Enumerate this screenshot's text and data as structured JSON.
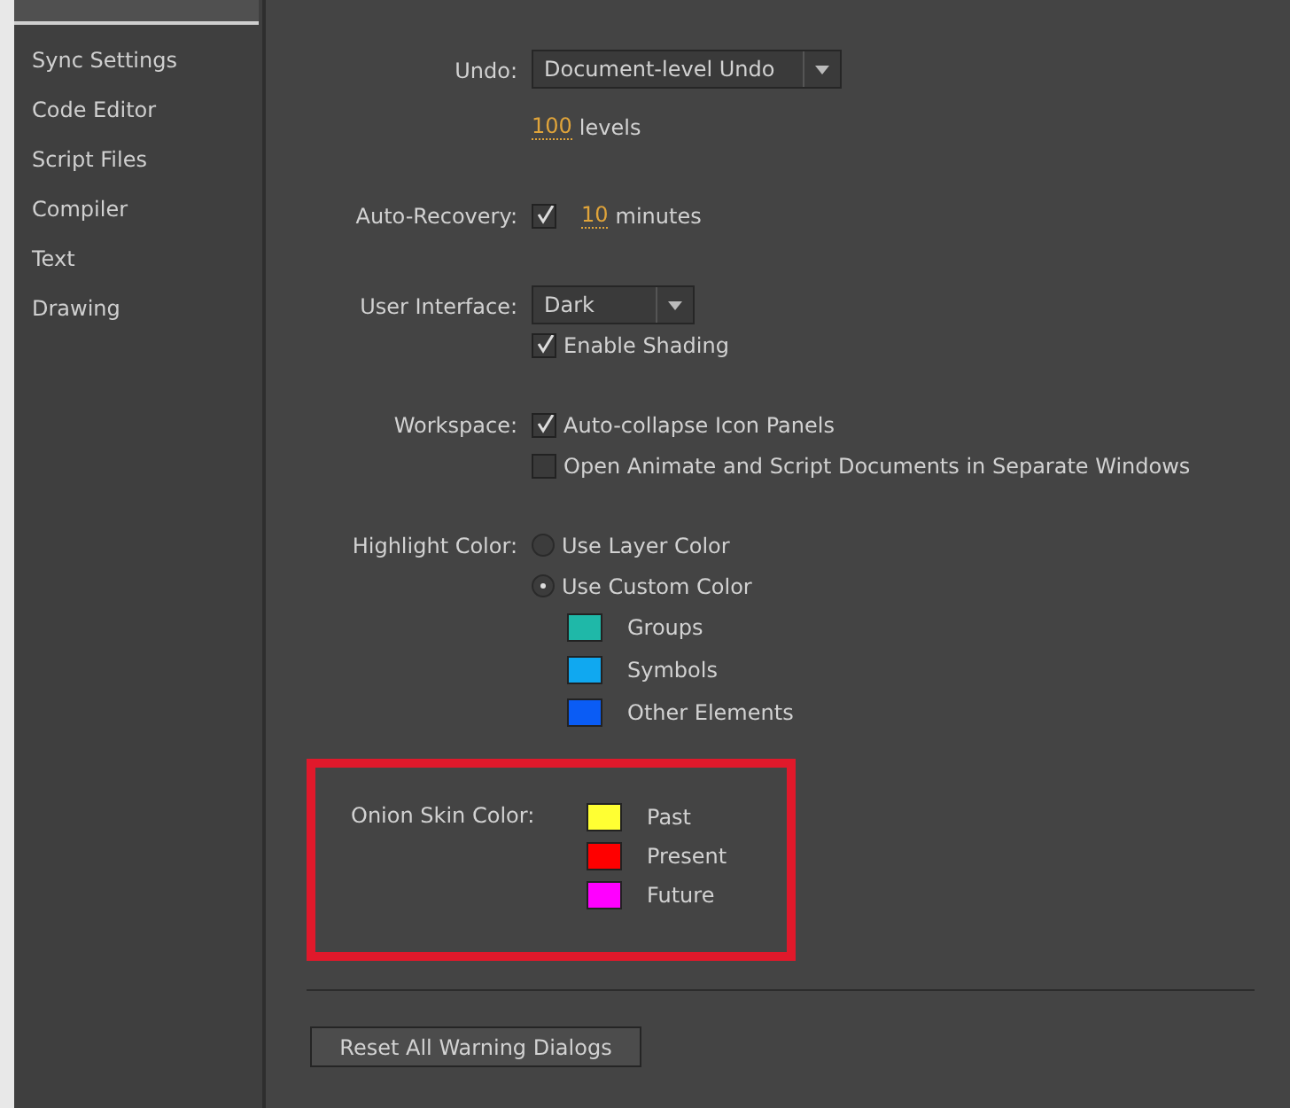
{
  "sidebar": {
    "items": [
      {
        "label": "Sync Settings",
        "selected": false
      },
      {
        "label": "Code Editor",
        "selected": false
      },
      {
        "label": "Script Files",
        "selected": false
      },
      {
        "label": "Compiler",
        "selected": false
      },
      {
        "label": "Text",
        "selected": false
      },
      {
        "label": "Drawing",
        "selected": false
      }
    ]
  },
  "undo": {
    "label": "Undo:",
    "value": "Document-level Undo",
    "amount": "100",
    "unit": "levels"
  },
  "auto_recovery": {
    "label": "Auto-Recovery:",
    "checked": true,
    "amount": "10",
    "unit": "minutes"
  },
  "user_interface": {
    "label": "User Interface:",
    "value": "Dark",
    "shading": {
      "label": "Enable Shading",
      "checked": true
    }
  },
  "workspace": {
    "label": "Workspace:",
    "options": [
      {
        "label": "Auto-collapse Icon Panels",
        "checked": true
      },
      {
        "label": "Open Animate and Script Documents in Separate Windows",
        "checked": false
      }
    ]
  },
  "highlight_color": {
    "label": "Highlight Color:",
    "options": [
      {
        "label": "Use Layer Color",
        "selected": false
      },
      {
        "label": "Use Custom Color",
        "selected": true
      }
    ],
    "swatches": [
      {
        "label": "Groups",
        "color": "#1fb8a8"
      },
      {
        "label": "Symbols",
        "color": "#10a8f0"
      },
      {
        "label": "Other Elements",
        "color": "#0a5cf5"
      }
    ]
  },
  "onion_skin": {
    "label": "Onion Skin Color:",
    "swatches": [
      {
        "label": "Past",
        "color": "#ffff33"
      },
      {
        "label": "Present",
        "color": "#ff0000"
      },
      {
        "label": "Future",
        "color": "#ff00ff"
      }
    ]
  },
  "reset_button": "Reset All Warning Dialogs"
}
